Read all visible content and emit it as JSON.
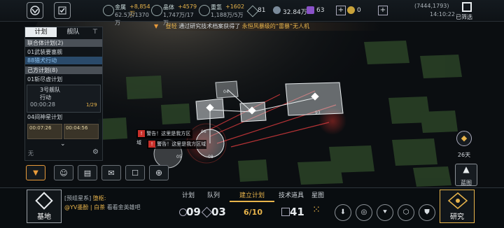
{
  "resources": [
    {
      "name": "金属",
      "delta": "+8,854万",
      "amount": "62.5万/1370万"
    },
    {
      "name": "晶体",
      "delta": "+4579",
      "amount": "1,747万/17万"
    },
    {
      "name": "重氢",
      "delta": "+1602",
      "amount": "1,188万/5万"
    }
  ],
  "energy": "81",
  "credits": "32.84万",
  "premium": "63",
  "tokens": "0",
  "coords": "(7444,1793)",
  "time": "14:10:22",
  "filter_label": "已筛选",
  "news": {
    "player": "昼轻",
    "text": "通过研究技术档案获得了",
    "item": "永恒风暴级的“雷暴”无人机"
  },
  "panel": {
    "tabs": [
      "计划",
      "舰队"
    ],
    "sections": [
      {
        "label": "联合体计划(2)"
      },
      {
        "label": "己方计划(8)"
      }
    ],
    "rows": [
      "01武装要塞舰",
      "88猎犬行动",
      "01斩尽虚计划",
      "04间神星计划"
    ],
    "fleet": {
      "name": "3号舰队",
      "status": "行动",
      "timer": "00:00:28",
      "code": "1/29"
    },
    "cards": [
      "00:07:26",
      "00:04:56"
    ],
    "empty": "无"
  },
  "map": {
    "warnings": [
      "警告！这里是我方区域",
      "警告！这里是我方区域"
    ],
    "labels": [
      "04",
      "06",
      "93",
      "05",
      "08"
    ]
  },
  "days": "26天",
  "bluprint_label": "蓝图",
  "base_label": "基地",
  "research_label": "研究",
  "chat": {
    "channel": "[预组星系]",
    "name1": "堕枢:",
    "line2": "@YV墨酚 | 白茶",
    "msg": "看看金英雄吧"
  },
  "tabs": [
    "计划",
    "队列",
    "建立计划",
    "技术道具",
    "星图"
  ],
  "counts": {
    "plans": "09",
    "queue": "03",
    "build": "6/10",
    "tech": "41"
  }
}
